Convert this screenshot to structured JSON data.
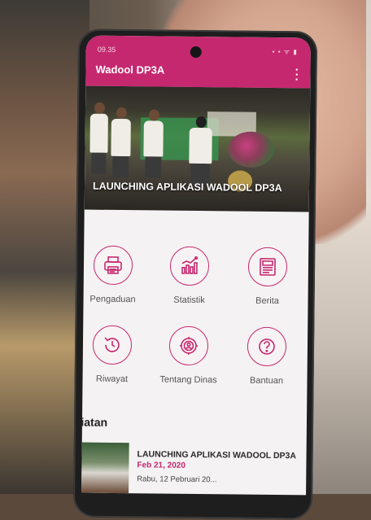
{
  "status_bar": {
    "time": "09.35",
    "icons": "▪ ▪ ᯤ ▮"
  },
  "appbar": {
    "title": "Wadool DP3A",
    "menu_icon": "overflow-menu-icon"
  },
  "banner": {
    "caption": "LAUNCHING APLIKASI WADOOL DP3A"
  },
  "menu": {
    "items": [
      {
        "label": "Pengaduan",
        "icon": "printer-icon"
      },
      {
        "label": "Statistik",
        "icon": "chart-icon"
      },
      {
        "label": "Berita",
        "icon": "newspaper-icon"
      },
      {
        "label": "Riwayat",
        "icon": "history-icon"
      },
      {
        "label": "Tentang Dinas",
        "icon": "gear-person-icon"
      },
      {
        "label": "Bantuan",
        "icon": "help-icon"
      }
    ]
  },
  "kegiatan": {
    "title": "Kegiatan",
    "items": [
      {
        "title": "LAUNCHING APLIKASI WADOOL DP3A",
        "date": "Feb 21, 2020",
        "subtitle": "Rabu, 12 Pebruari 20..."
      }
    ]
  },
  "colors": {
    "accent": "#c6286f",
    "background": "#f4f2f2"
  }
}
